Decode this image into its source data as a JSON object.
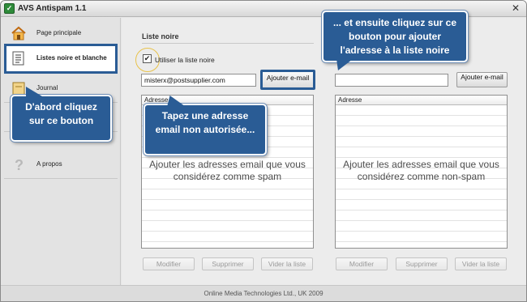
{
  "window": {
    "title": "AVS Antispam 1.1",
    "close_glyph": "✕"
  },
  "sidebar": {
    "items": [
      {
        "label": "Page principale",
        "icon": "home-icon"
      },
      {
        "label": "Listes noire et blanche",
        "icon": "list-icon"
      },
      {
        "label": "Journal",
        "icon": "journal-icon"
      },
      {
        "label": "",
        "icon": "settings-icon"
      },
      {
        "label": "A propos",
        "icon": "question-icon"
      }
    ]
  },
  "blacklist": {
    "section_title": "Liste noire",
    "use_checkbox_label": "Utiliser la liste noire",
    "use_checkbox_checked": true,
    "email_value": "misterx@postsupplier.com",
    "add_button": "Ajouter e-mail",
    "column_header": "Adresse",
    "hint": "Ajouter les adresses email que vous considérez comme spam",
    "modify_button": "Modifier",
    "delete_button": "Supprimer",
    "clear_button": "Vider la liste"
  },
  "whitelist": {
    "email_value": "",
    "add_button": "Ajouter e-mail",
    "column_header": "Adresse",
    "hint": "Ajouter les adresses email que vous considérez comme non-spam",
    "modify_button": "Modifier",
    "delete_button": "Supprimer",
    "clear_button": "Vider la liste"
  },
  "footer": {
    "text": "Online Media Technologies Ltd., UK 2009"
  },
  "callouts": {
    "first": "D'abord cliquez sur ce bouton",
    "second": "Tapez une adresse email non autorisée...",
    "third": "... et ensuite cliquez sur ce bouton pour ajouter l'adresse à la liste noire"
  },
  "colors": {
    "accent": "#2a5c95"
  }
}
